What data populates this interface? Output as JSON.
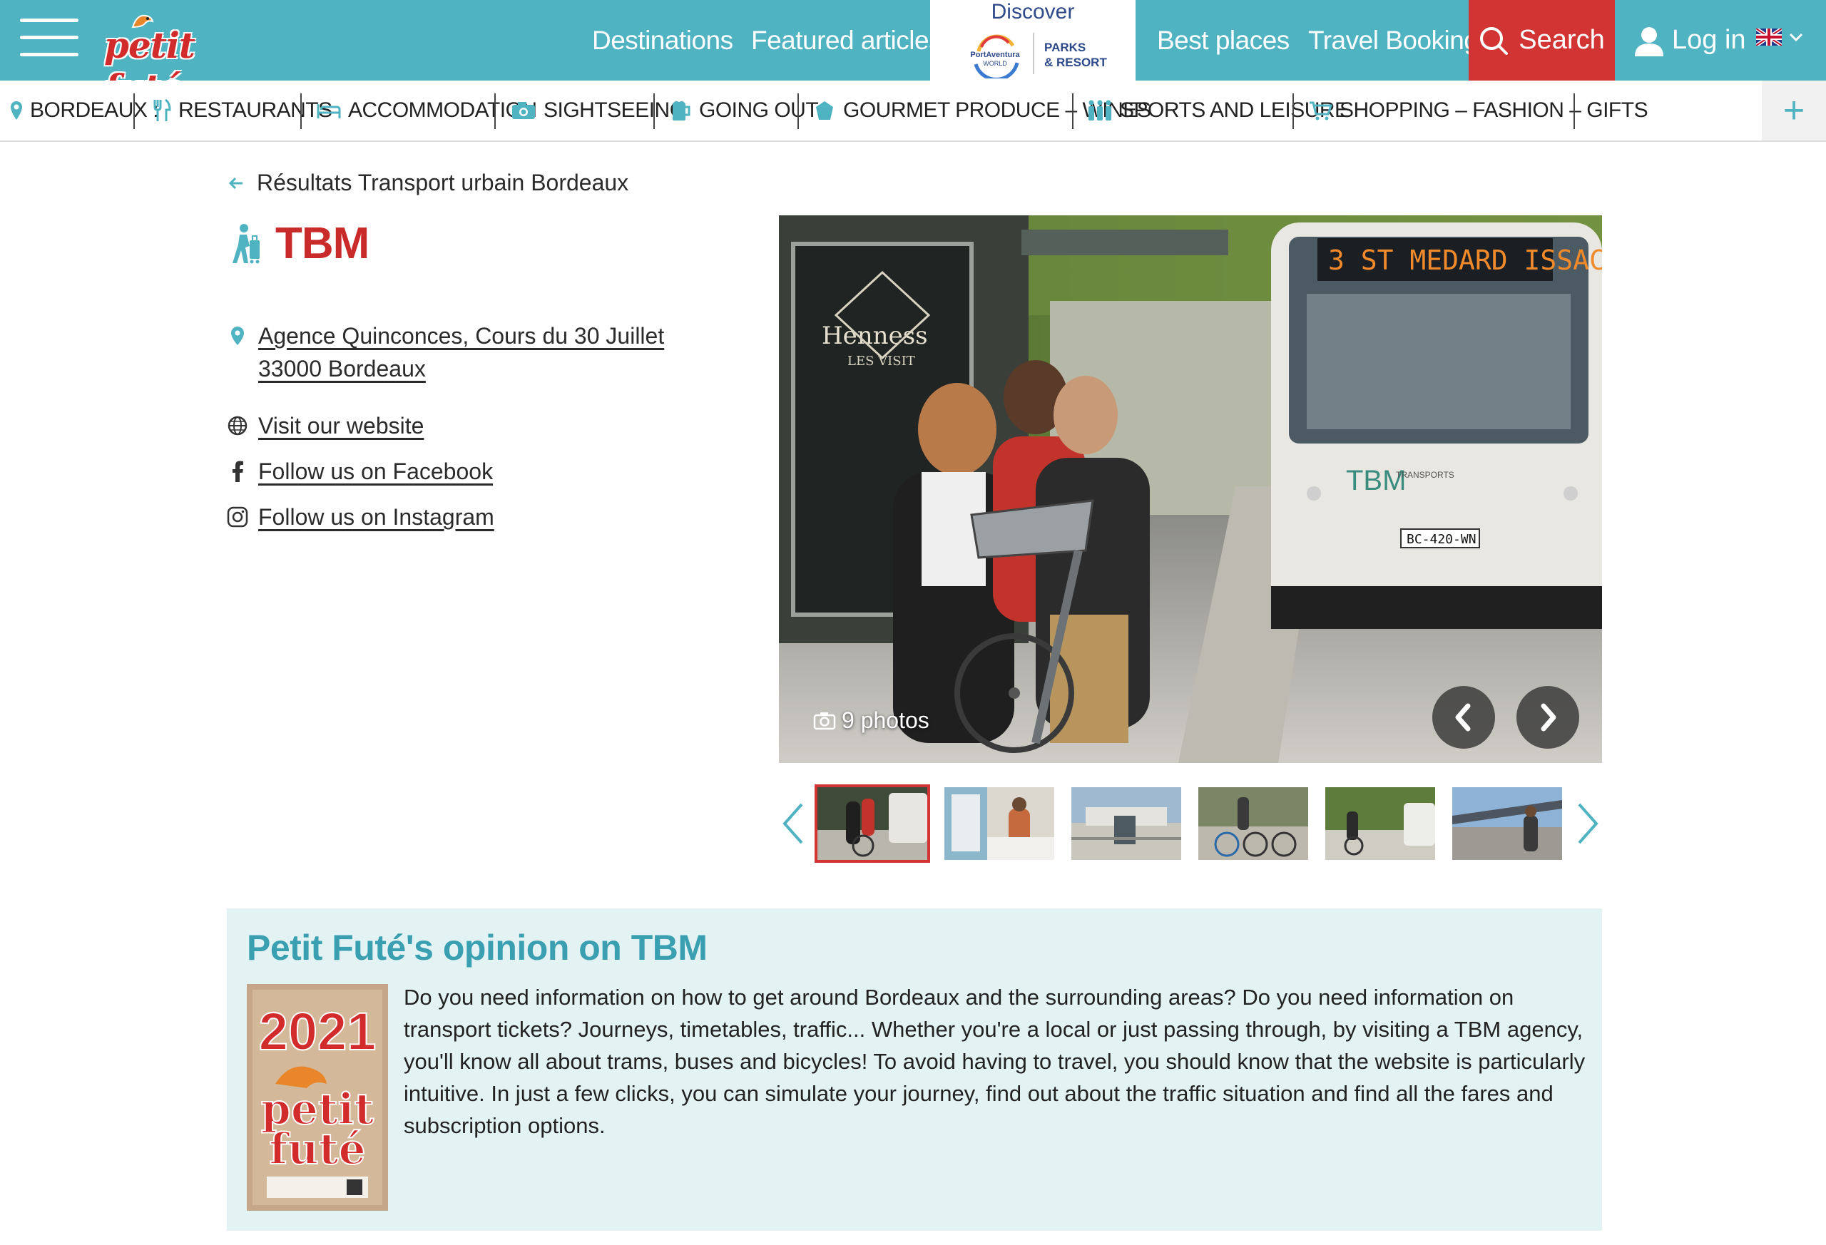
{
  "header": {
    "logo_text": "petit futé",
    "nav": {
      "destinations": "Destinations",
      "featured": "Featured articles",
      "discover": "Discover",
      "partner_line1": "PARKS",
      "partner_line2": "& RESORT",
      "partner_brand": "PortAventura WORLD",
      "best_places": "Best places",
      "travel_booking": "Travel Booking",
      "search": "Search",
      "login": "Log in"
    },
    "colors": {
      "primary": "#4fb3c2",
      "search": "#d23434",
      "title": "#c92a2a"
    }
  },
  "categories": {
    "location": "BORDEAUX :",
    "items": [
      {
        "label": "RESTAURANTS",
        "icon": "fork-knife-icon"
      },
      {
        "label": "ACCOMMODATION",
        "icon": "bed-icon"
      },
      {
        "label": "SIGHTSEEING",
        "icon": "camera-icon"
      },
      {
        "label": "GOING OUT",
        "icon": "beer-icon"
      },
      {
        "label": "GOURMET PRODUCE – WINES",
        "icon": "basket-icon"
      },
      {
        "label": "SPORTS AND LEISURE",
        "icon": "bottles-icon"
      },
      {
        "label": "SHOPPING – FASHION – GIFTS",
        "icon": "cart-icon"
      }
    ],
    "more": "+"
  },
  "page": {
    "back_label": "Résultats Transport urbain Bordeaux",
    "title": "TBM",
    "address_line1": "Agence Quinconces, Cours du 30 Juillet",
    "address_line2": "33000 Bordeaux",
    "website": "Visit our website",
    "facebook": "Follow us on Facebook",
    "instagram": "Follow us on Instagram"
  },
  "gallery": {
    "photos_label": "9 photos",
    "thumb_count": 6,
    "active_thumb": 1
  },
  "opinion": {
    "title": "Petit Futé's opinion on TBM",
    "badge_year": "2021",
    "badge_brand": "petit futé",
    "text": "Do you need information on how to get around Bordeaux and the surrounding areas? Do you need information on transport tickets? Journeys, timetables, traffic... Whether you're a local or just passing through, by visiting a TBM agency, you'll know all about trams, buses and bicycles! To avoid having to travel, you should know that the website is particularly intuitive. In just a few clicks, you can simulate your journey, find out about the traffic situation and find all the fares and subscription options."
  }
}
